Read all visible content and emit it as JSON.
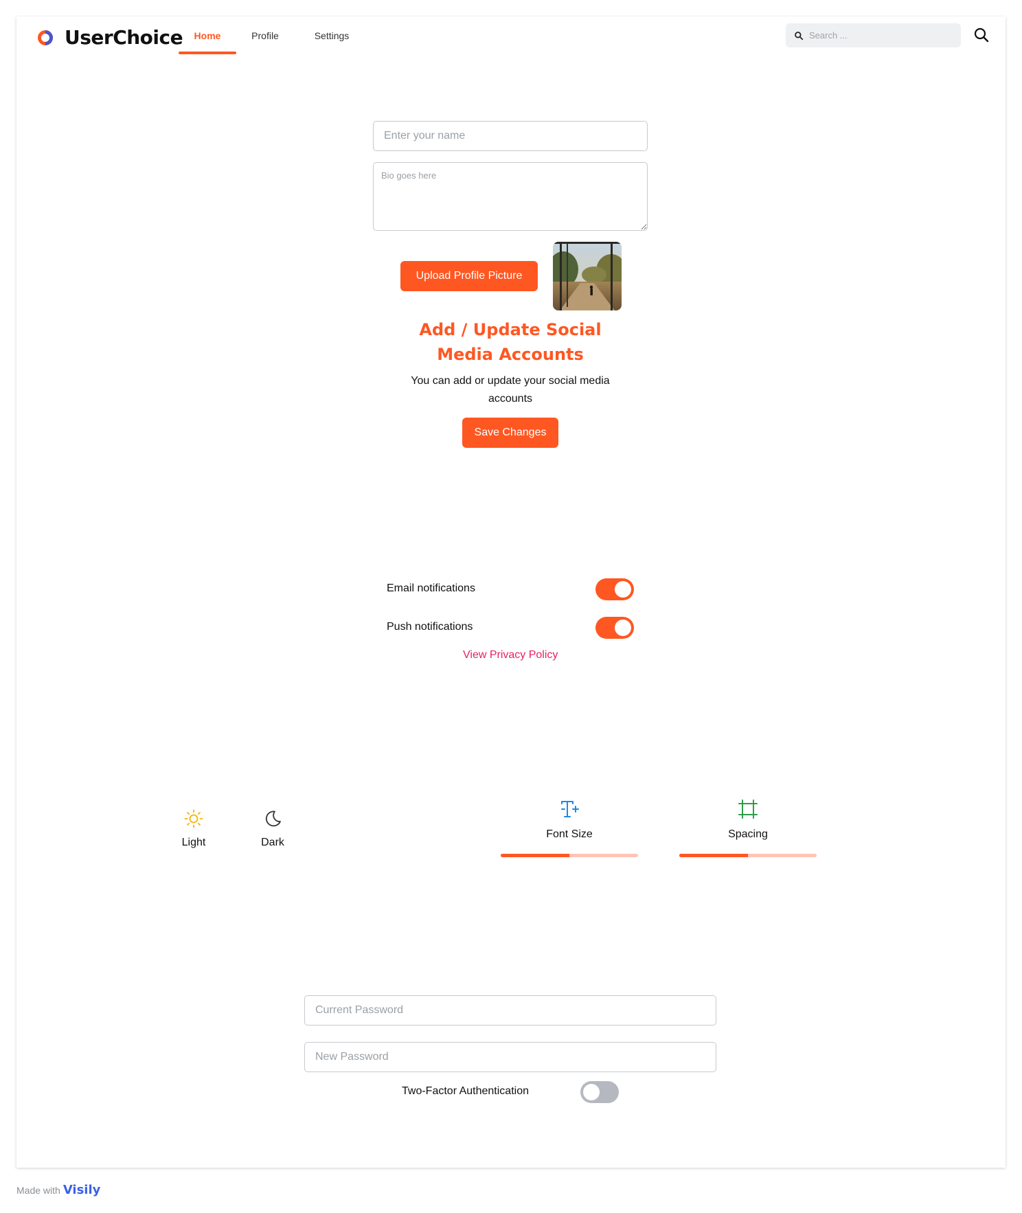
{
  "header": {
    "app_name": "UserChoice",
    "tabs": [
      {
        "label": "Home",
        "active": true
      },
      {
        "label": "Profile",
        "active": false
      },
      {
        "label": "Settings",
        "active": false
      }
    ],
    "search_placeholder": "Search ..."
  },
  "profile": {
    "name_placeholder": "Enter your name",
    "bio_placeholder": "Bio goes here",
    "upload_label": "Upload Profile Picture",
    "social_title": "Add / Update Social Media Accounts",
    "social_description": "You can add or update your social media accounts",
    "save_label": "Save Changes"
  },
  "notifications": {
    "items": [
      {
        "label": "Email notifications",
        "enabled": true
      },
      {
        "label": "Push notifications",
        "enabled": true
      }
    ],
    "privacy_link": "View Privacy Policy"
  },
  "appearance": {
    "themes": [
      {
        "label": "Light",
        "icon": "sun-icon"
      },
      {
        "label": "Dark",
        "icon": "moon-icon"
      }
    ],
    "controls": [
      {
        "label": "Font Size",
        "icon": "font-size-icon",
        "value_percent": 50
      },
      {
        "label": "Spacing",
        "icon": "spacing-icon",
        "value_percent": 50
      }
    ]
  },
  "security": {
    "current_password_placeholder": "Current Password",
    "new_password_placeholder": "New Password",
    "two_factor_label": "Two-Factor Authentication",
    "two_factor_enabled": false
  },
  "footer": {
    "made_with": "Made with",
    "brand": "Visily"
  },
  "colors": {
    "accent": "#ff5722",
    "link": "#e91e63",
    "light_icon": "#f5b400",
    "font_size_icon": "#1e88e5",
    "spacing_icon": "#2e9e4a"
  }
}
